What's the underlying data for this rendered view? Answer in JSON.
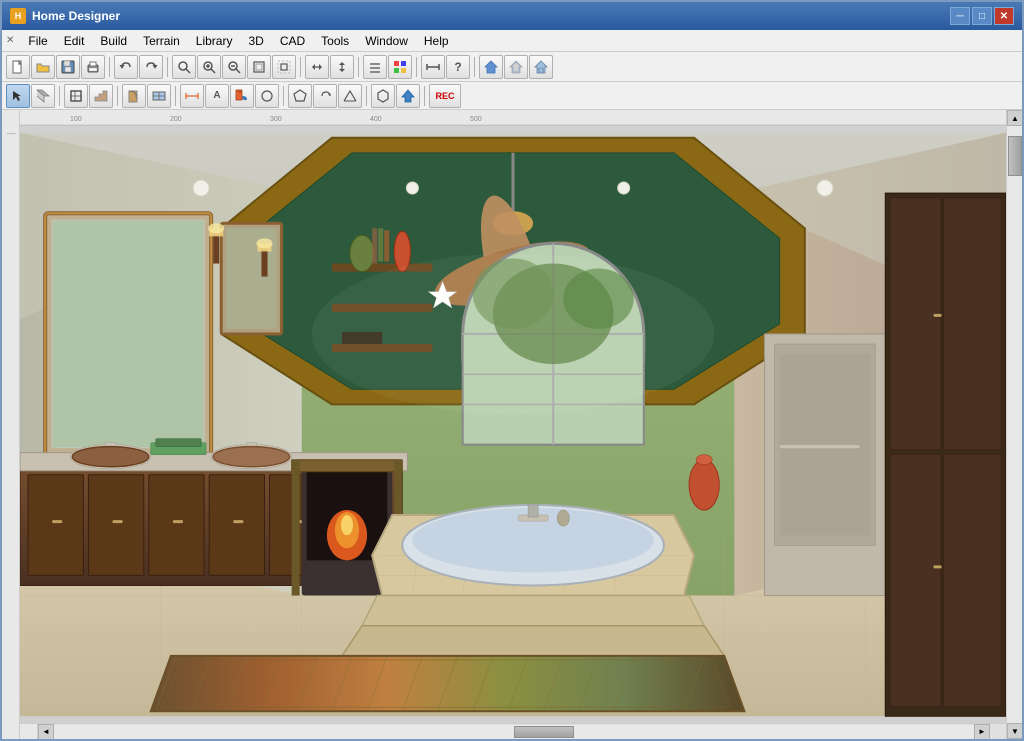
{
  "window": {
    "title": "Home Designer",
    "icon": "H"
  },
  "title_controls": {
    "minimize": "─",
    "restore": "□",
    "close": "✕"
  },
  "menu": {
    "items": [
      "File",
      "Edit",
      "Build",
      "Terrain",
      "Library",
      "3D",
      "CAD",
      "Tools",
      "Window",
      "Help"
    ]
  },
  "toolbar1": {
    "buttons": [
      {
        "label": "📄",
        "name": "new"
      },
      {
        "label": "📁",
        "name": "open"
      },
      {
        "label": "💾",
        "name": "save"
      },
      {
        "label": "🖨",
        "name": "print"
      },
      {
        "label": "↩",
        "name": "undo"
      },
      {
        "label": "↪",
        "name": "redo"
      },
      {
        "label": "🔍",
        "name": "zoom-in-tool"
      },
      {
        "label": "⊕",
        "name": "zoom-in"
      },
      {
        "label": "⊖",
        "name": "zoom-out"
      },
      {
        "label": "⊞",
        "name": "fit-all"
      },
      {
        "label": "⊡",
        "name": "fit-sel"
      },
      {
        "label": "↔",
        "name": "pan"
      },
      {
        "label": "↕",
        "name": "pan-v"
      },
      {
        "label": "≡",
        "name": "layers"
      },
      {
        "label": "?",
        "name": "help"
      },
      {
        "label": "⌂",
        "name": "home1"
      },
      {
        "label": "⌂",
        "name": "home2"
      },
      {
        "label": "⌂",
        "name": "home3"
      }
    ]
  },
  "toolbar2": {
    "buttons": [
      {
        "label": "↖",
        "name": "select"
      },
      {
        "label": "∟",
        "name": "wall-tool"
      },
      {
        "label": "⊟",
        "name": "room-tool"
      },
      {
        "label": "⊠",
        "name": "door-tool"
      },
      {
        "label": "⊡",
        "name": "window-tool"
      },
      {
        "label": "∎",
        "name": "stair-tool"
      },
      {
        "label": "◈",
        "name": "dimension"
      },
      {
        "label": "✏",
        "name": "text"
      },
      {
        "label": "🎨",
        "name": "paint"
      },
      {
        "label": "◉",
        "name": "circle"
      },
      {
        "label": "⬠",
        "name": "polygon"
      },
      {
        "label": "⟳",
        "name": "rotate"
      },
      {
        "label": "↑",
        "name": "elevation"
      },
      {
        "label": "⬡",
        "name": "hex"
      },
      {
        "label": "REC",
        "name": "record"
      }
    ]
  },
  "viewport": {
    "scene": "3D bathroom interior render",
    "description": "Luxury bathroom with ceiling fan, octagonal tray ceiling, bathtub, vanity, and arched window"
  },
  "scrollbars": {
    "up": "▲",
    "down": "▼",
    "left": "◄",
    "right": "►"
  }
}
